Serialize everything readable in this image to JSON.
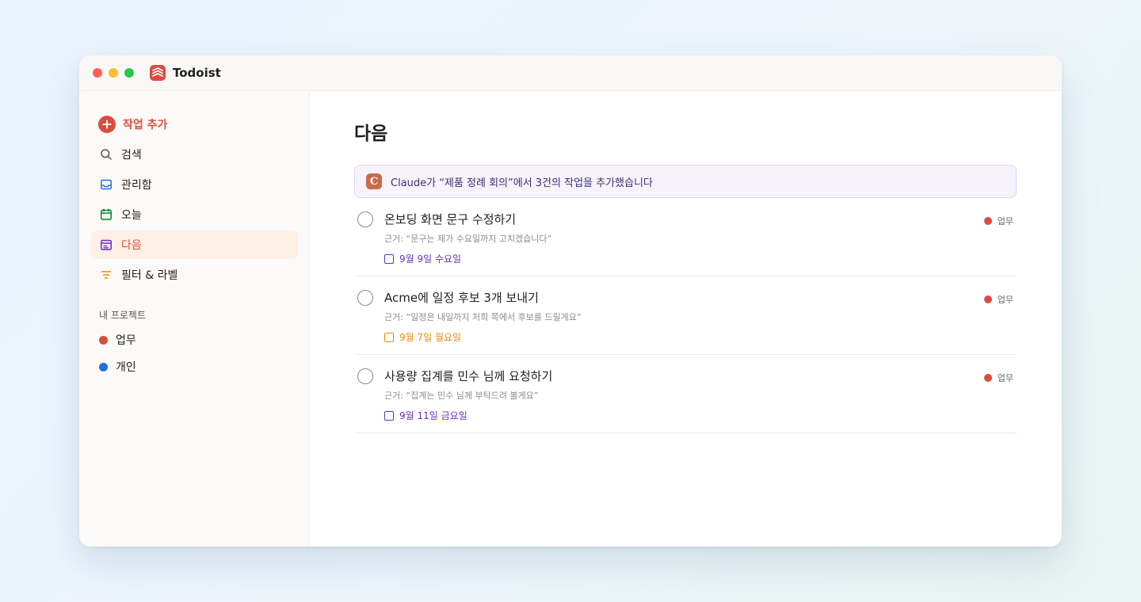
{
  "app": {
    "name": "Todoist"
  },
  "sidebar": {
    "add_task": "작업 추가",
    "items": [
      {
        "label": "검색",
        "icon": "search-icon",
        "color": "#555555"
      },
      {
        "label": "관리함",
        "icon": "inbox-icon",
        "color": "#246fe0"
      },
      {
        "label": "오늘",
        "icon": "calendar-today-icon",
        "color": "#058527"
      },
      {
        "label": "다음",
        "icon": "calendar-upcoming-icon",
        "color": "#692fc2",
        "active": true
      },
      {
        "label": "필터 & 라벨",
        "icon": "filter-icon",
        "color": "#eb8909"
      }
    ],
    "projects_title": "내 프로젝트",
    "projects": [
      {
        "label": "업무",
        "color": "#dc4c3e"
      },
      {
        "label": "개인",
        "color": "#246fe0"
      }
    ]
  },
  "main": {
    "title": "다음",
    "banner": {
      "icon_letter": "C",
      "text": "Claude가 “제품 정례 회의”에서 3건의 작업을 추가했습니다"
    },
    "tasks": [
      {
        "title": "온보딩 화면 문구 수정하기",
        "source": "근거: “문구는 제가 수요일까지 고치겠습니다”",
        "due": "9월 9일 수요일",
        "due_color": "#692fc2",
        "project": "업무",
        "project_color": "#dc4c3e"
      },
      {
        "title": "Acme에 일정 후보 3개 보내기",
        "source": "근거: “일정은 내일까지 저희 쪽에서 후보를 드릴게요”",
        "due": "9월 7일 월요일",
        "due_color": "#eb8909",
        "project": "업무",
        "project_color": "#dc4c3e"
      },
      {
        "title": "사용량 집계를 민수 님께 요청하기",
        "source": "근거: “집계는 민수 님께 부탁드려 볼게요”",
        "due": "9월 11일 금요일",
        "due_color": "#692fc2",
        "project": "업무",
        "project_color": "#dc4c3e"
      }
    ]
  }
}
